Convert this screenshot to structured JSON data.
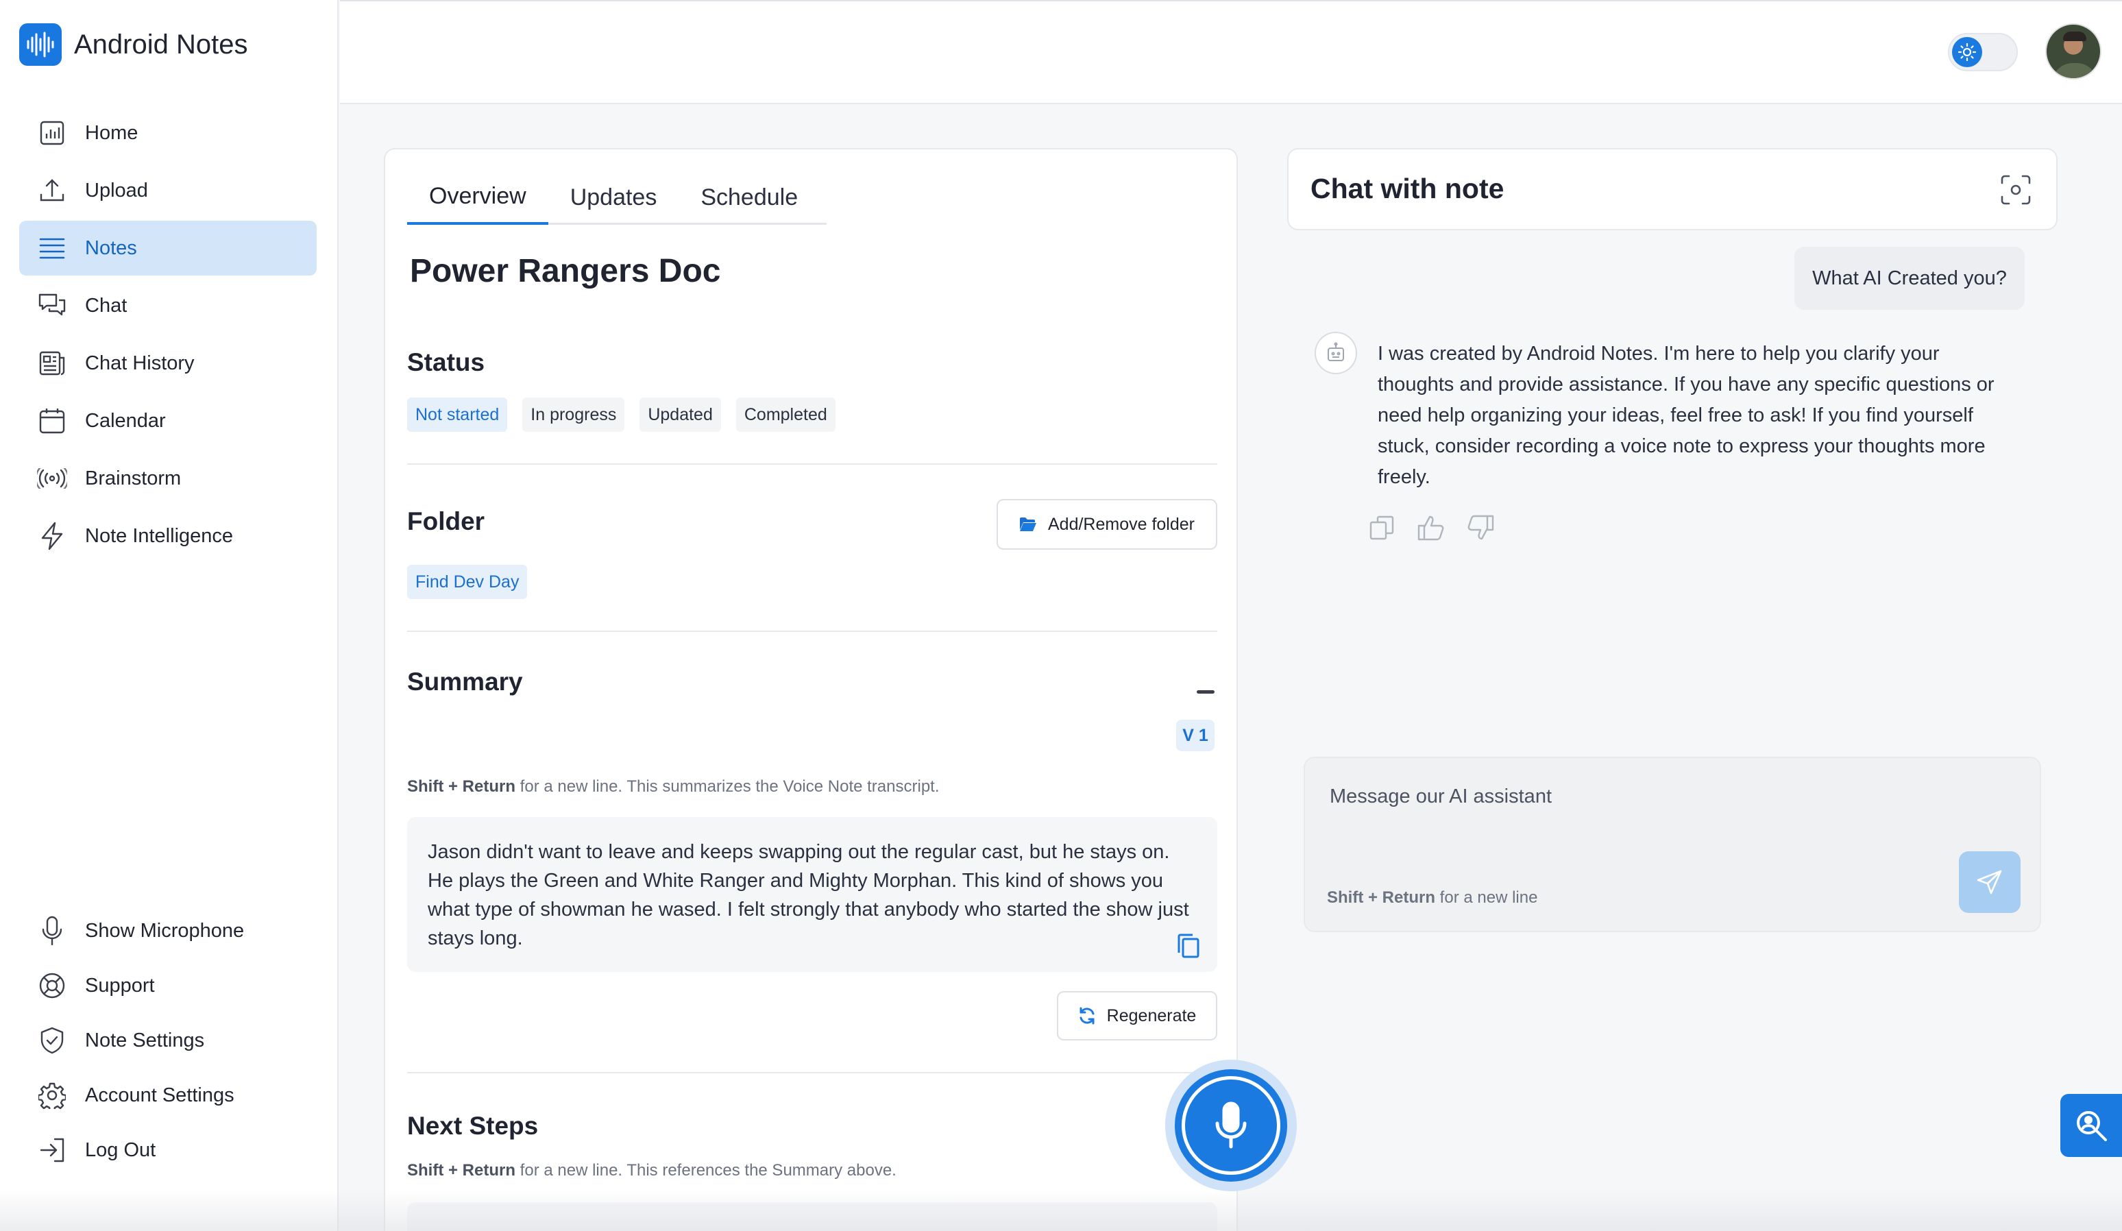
{
  "app": {
    "name": "Android Notes",
    "logo_icon": "audio-wave-icon",
    "brand_color": "#1a7ae0"
  },
  "sidebar": {
    "top_items": [
      {
        "label": "Home",
        "icon": "bar-chart-icon",
        "active": false
      },
      {
        "label": "Upload",
        "icon": "upload-icon",
        "active": false
      },
      {
        "label": "Notes",
        "icon": "list-icon",
        "active": true
      },
      {
        "label": "Chat",
        "icon": "chat-bubbles-icon",
        "active": false
      },
      {
        "label": "Chat History",
        "icon": "newspaper-icon",
        "active": false
      },
      {
        "label": "Calendar",
        "icon": "calendar-icon",
        "active": false
      },
      {
        "label": "Brainstorm",
        "icon": "broadcast-icon",
        "active": false
      },
      {
        "label": "Note Intelligence",
        "icon": "lightning-icon",
        "active": false
      }
    ],
    "bottom_items": [
      {
        "label": "Show Microphone",
        "icon": "microphone-icon"
      },
      {
        "label": "Support",
        "icon": "lifebuoy-icon"
      },
      {
        "label": "Note Settings",
        "icon": "shield-check-icon"
      },
      {
        "label": "Account Settings",
        "icon": "gear-icon"
      },
      {
        "label": "Log Out",
        "icon": "logout-icon"
      }
    ]
  },
  "topbar": {
    "theme_toggle_icon": "sun-icon",
    "avatar": "user-avatar"
  },
  "note": {
    "tabs": [
      "Overview",
      "Updates",
      "Schedule"
    ],
    "active_tab": "Overview",
    "title": "Power Rangers Doc",
    "status": {
      "heading": "Status",
      "options": [
        "Not started",
        "In progress",
        "Updated",
        "Completed"
      ],
      "selected": "Not started"
    },
    "folder": {
      "heading": "Folder",
      "button_label": "Add/Remove folder",
      "tag": "Find Dev Day"
    },
    "summary": {
      "heading": "Summary",
      "version": "V 1",
      "hint_key": "Shift + Return",
      "hint_text": " for a new line. This summarizes the Voice Note transcript.",
      "text": "Jason didn't want to leave and keeps swapping out the regular cast, but he stays on. He plays the Green and White Ranger and Mighty Morphan. This kind of shows you what type of showman he wased. I felt strongly that anybody who started the show just stays long.",
      "regenerate_label": "Regenerate"
    },
    "next_steps": {
      "heading": "Next Steps",
      "hint_key": "Shift + Return",
      "hint_text": " for a new line. This references the Summary above."
    }
  },
  "chat": {
    "title": "Chat with note",
    "user_message": "What AI Created you?",
    "bot_message": "I was created by Android Notes. I'm here to help you clarify your thoughts and provide assistance. If you have any specific questions or need help organizing your ideas, feel free to ask! If you find yourself stuck, consider recording a voice note to express your thoughts more freely.",
    "composer_placeholder": "Message our AI assistant",
    "composer_hint_key": "Shift + Return",
    "composer_hint_text": " for a new line"
  }
}
